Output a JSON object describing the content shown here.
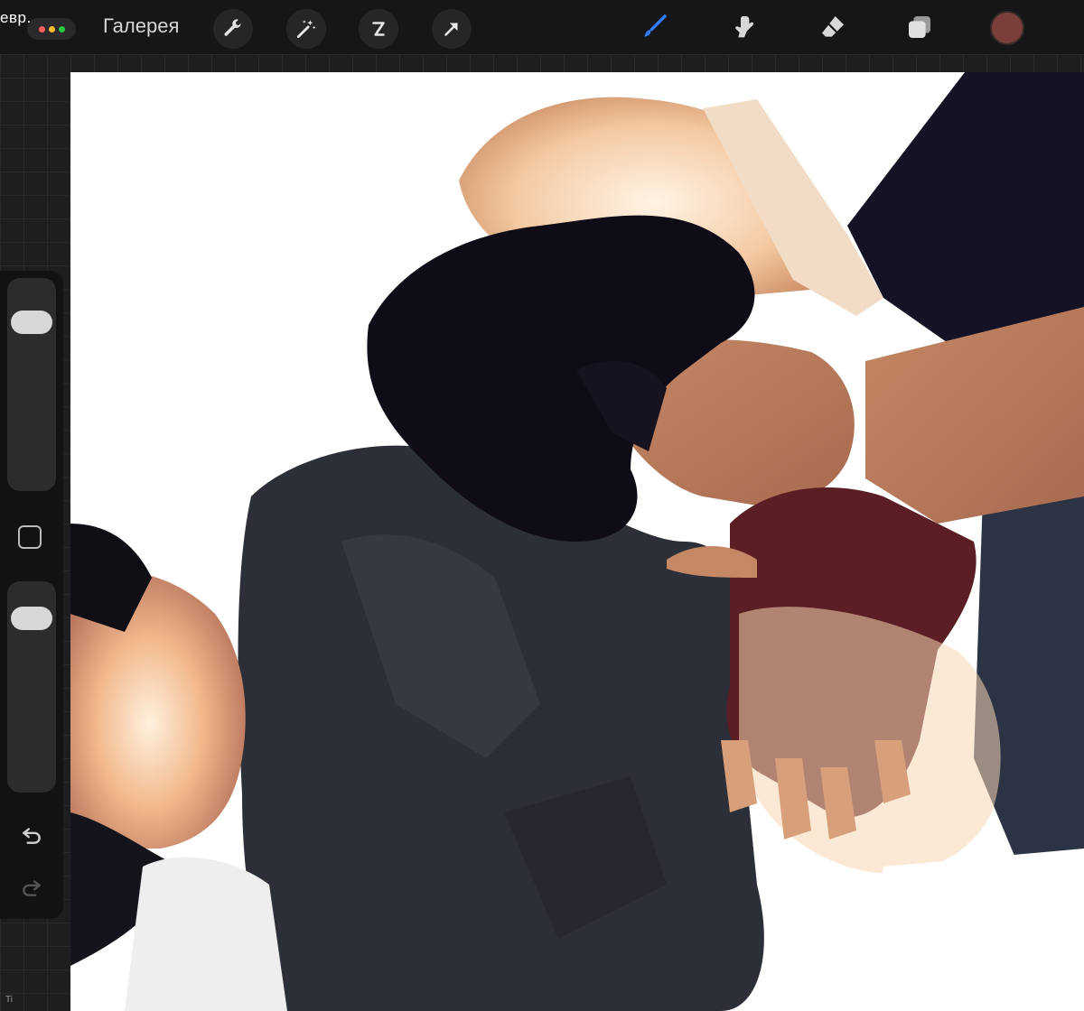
{
  "status": {
    "date_fragment": "евр."
  },
  "header": {
    "gallery_label": "Галерея"
  },
  "tools_left": [
    {
      "name": "wrench-icon"
    },
    {
      "name": "magic-wand-icon"
    },
    {
      "name": "selection-icon"
    },
    {
      "name": "transform-arrow-icon"
    }
  ],
  "tools_right": [
    {
      "name": "brush-icon",
      "active": true
    },
    {
      "name": "smudge-icon"
    },
    {
      "name": "eraser-icon"
    },
    {
      "name": "layers-icon"
    }
  ],
  "colors": {
    "accent": "#2f7cf6",
    "current_color": "#7a3f3a",
    "dot_red": "#ff5f57",
    "dot_yellow": "#febc2e",
    "dot_green": "#28c840"
  },
  "sidebar": {
    "brush_size_level": 0.88,
    "opacity_level": 0.88
  },
  "bottom": {
    "mark": "Ti"
  }
}
